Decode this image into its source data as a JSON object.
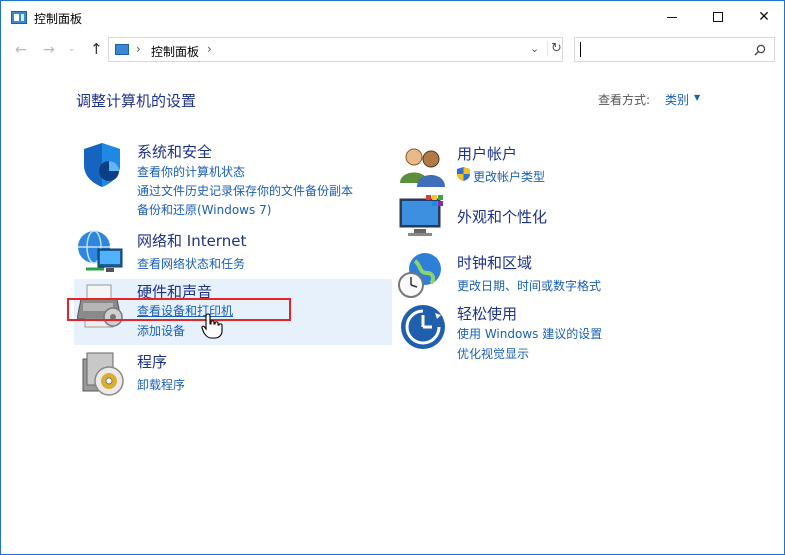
{
  "window": {
    "title": "控制面板"
  },
  "address": {
    "separator": "›",
    "path": "控制面板",
    "search_placeholder": ""
  },
  "content": {
    "heading": "调整计算机的设置",
    "view_by_label": "查看方式:",
    "view_by_value": "类别"
  },
  "categories": [
    {
      "title": "系统和安全",
      "links": [
        "查看你的计算机状态",
        "通过文件历史记录保存你的文件备份副本",
        "备份和还原(Windows 7)"
      ]
    },
    {
      "title": "网络和 Internet",
      "links": [
        "查看网络状态和任务"
      ]
    },
    {
      "title": "硬件和声音",
      "links": [
        "查看设备和打印机",
        "添加设备"
      ]
    },
    {
      "title": "程序",
      "links": [
        "卸载程序"
      ]
    },
    {
      "title": "用户帐户",
      "links": [
        "更改帐户类型"
      ]
    },
    {
      "title": "外观和个性化",
      "links": []
    },
    {
      "title": "时钟和区域",
      "links": [
        "更改日期、时间或数字格式"
      ]
    },
    {
      "title": "轻松使用",
      "links": [
        "使用 Windows 建议的设置",
        "优化视觉显示"
      ]
    }
  ],
  "colors": {
    "heading": "#1e3287",
    "link": "#1a5fb4",
    "highlight_panel": "#e6f1fb",
    "annotation_box": "#e0262a",
    "window_border": "#1e73c9"
  }
}
